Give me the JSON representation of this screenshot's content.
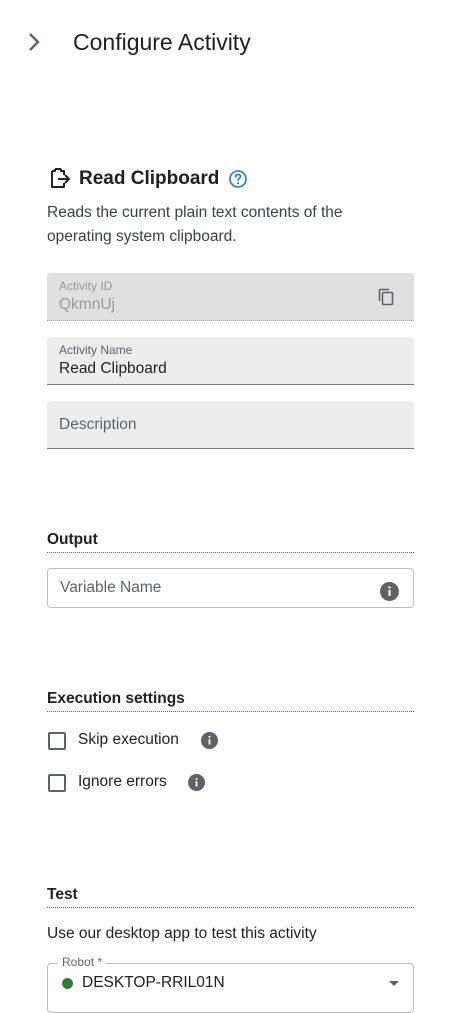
{
  "header": {
    "title": "Configure Activity"
  },
  "activity": {
    "title": "Read Clipboard",
    "description": "Reads the current plain text contents of the operating system clipboard."
  },
  "fields": {
    "activity_id": {
      "label": "Activity ID",
      "value": "QkmnUj"
    },
    "activity_name": {
      "label": "Activity Name",
      "value": "Read Clipboard"
    },
    "description": {
      "placeholder": "Description"
    }
  },
  "output": {
    "title": "Output",
    "variable_placeholder": "Variable Name"
  },
  "execution": {
    "title": "Execution settings",
    "skip_label": "Skip execution",
    "ignore_label": "Ignore errors",
    "skip_checked": false,
    "ignore_checked": false
  },
  "test": {
    "title": "Test",
    "description": "Use our desktop app to test this activity",
    "robot_label": "Robot *",
    "robot_value": "DESKTOP-RRIL01N",
    "robot_status_color": "#2e7d32"
  },
  "colors": {
    "accent": "#1a73e8",
    "text": "#202124",
    "muted": "#5f6368"
  }
}
